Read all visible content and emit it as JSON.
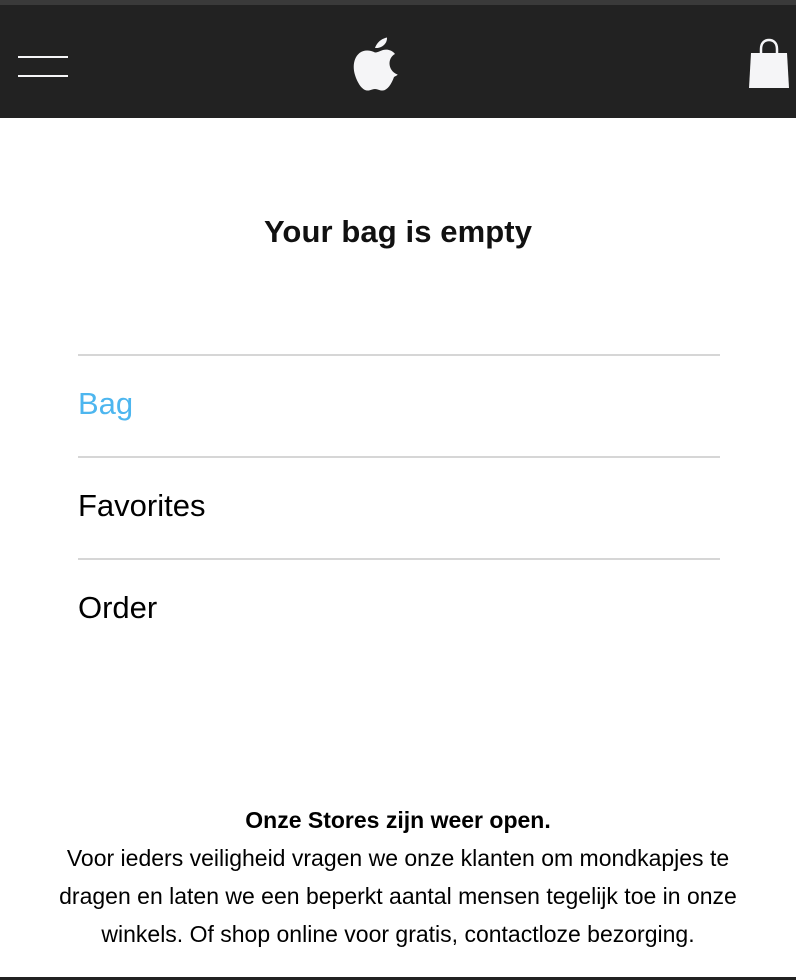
{
  "header": {
    "menu_icon": "hamburger-menu-icon",
    "logo_icon": "apple-logo-icon",
    "bag_icon": "shopping-bag-icon",
    "background_color": "#222222"
  },
  "main": {
    "empty_message": "Your bag is empty",
    "links": [
      {
        "label": "Bag",
        "active": true
      },
      {
        "label": "Favorites",
        "active": false
      },
      {
        "label": "Order",
        "active": false
      }
    ],
    "active_color": "#4db6ef"
  },
  "notice": {
    "title": "Onze Stores zijn weer open.",
    "body": "Voor ieders veiligheid vragen we onze klanten om mondkapjes te dragen en laten we een beperkt aantal mensen tegelijk toe in onze winkels. Of shop online voor gratis, contactloze bezorging."
  }
}
